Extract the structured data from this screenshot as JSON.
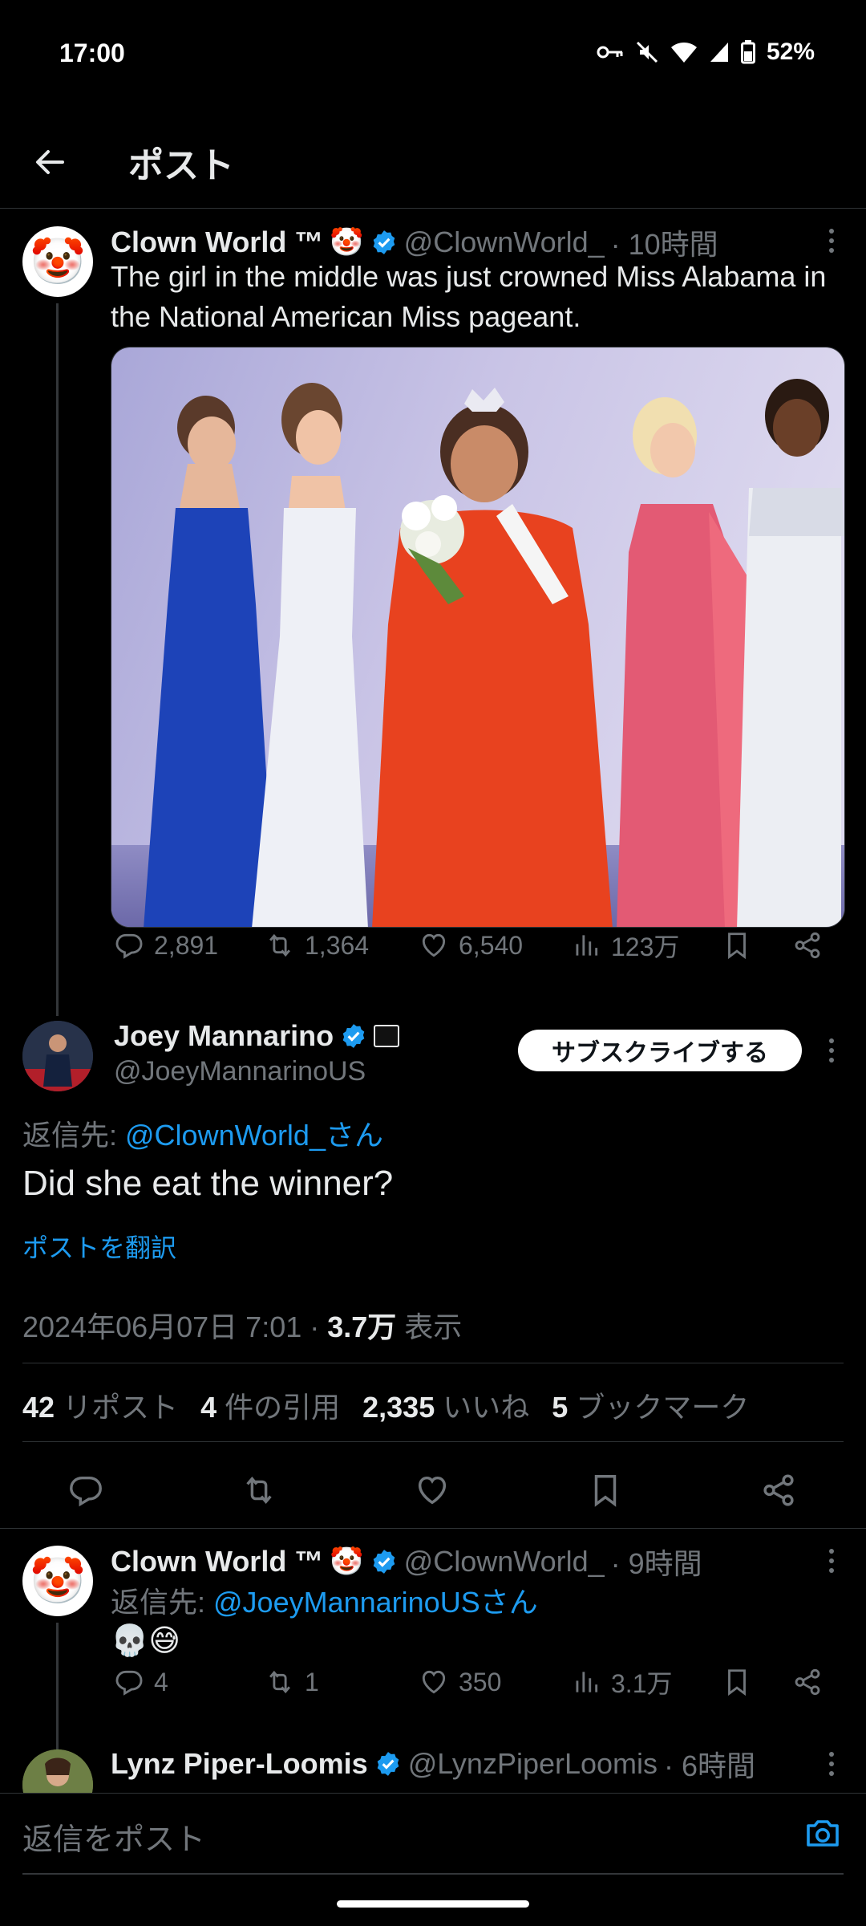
{
  "status_bar": {
    "time": "17:00",
    "battery": "52%"
  },
  "header": {
    "title": "ポスト"
  },
  "main_post": {
    "name": "Clown World ™",
    "emoji": "🤡",
    "handle": "@ClownWorld_",
    "time": "· 10時間",
    "text": "The girl in the middle was just crowned Miss Alabama in the National American Miss pageant.",
    "replies": "2,891",
    "reposts": "1,364",
    "likes": "6,540",
    "views": "123万"
  },
  "focused_post": {
    "name": "Joey Mannarino",
    "handle": "@JoeyMannarinoUS",
    "subscribe_label": "サブスクライブする",
    "reply_to_prefix": "返信先: ",
    "reply_to_handle": "@ClownWorld_さん",
    "text": "Did she eat the winner?",
    "translate": "ポストを翻訳",
    "datetime": "2024年06月07日 7:01 · ",
    "views_count": "3.7万",
    "views_label": " 表示",
    "reposts_count": "42",
    "reposts_label": "リポスト",
    "quotes_count": "4",
    "quotes_label": "件の引用",
    "likes_count": "2,335",
    "likes_label": "いいね",
    "bookmarks_count": "5",
    "bookmarks_label": "ブックマーク"
  },
  "reply_post": {
    "name": "Clown World ™",
    "emoji": "🤡",
    "handle": "@ClownWorld_",
    "time": "· 9時間",
    "reply_to_prefix": "返信先: ",
    "reply_to_handle": "@JoeyMannarinoUSさん",
    "text": "💀😅",
    "replies": "4",
    "reposts": "1",
    "likes": "350",
    "views": "3.1万"
  },
  "next_post": {
    "name": "Lynz Piper-Loomis",
    "handle": "@LynzPiperLoomis",
    "time": "· 6時間"
  },
  "reply_bar": {
    "placeholder": "返信をポスト"
  },
  "colors": {
    "background": "#000000",
    "text": "#e7e9ea",
    "muted": "#71767b",
    "accent": "#1d9bf0"
  }
}
